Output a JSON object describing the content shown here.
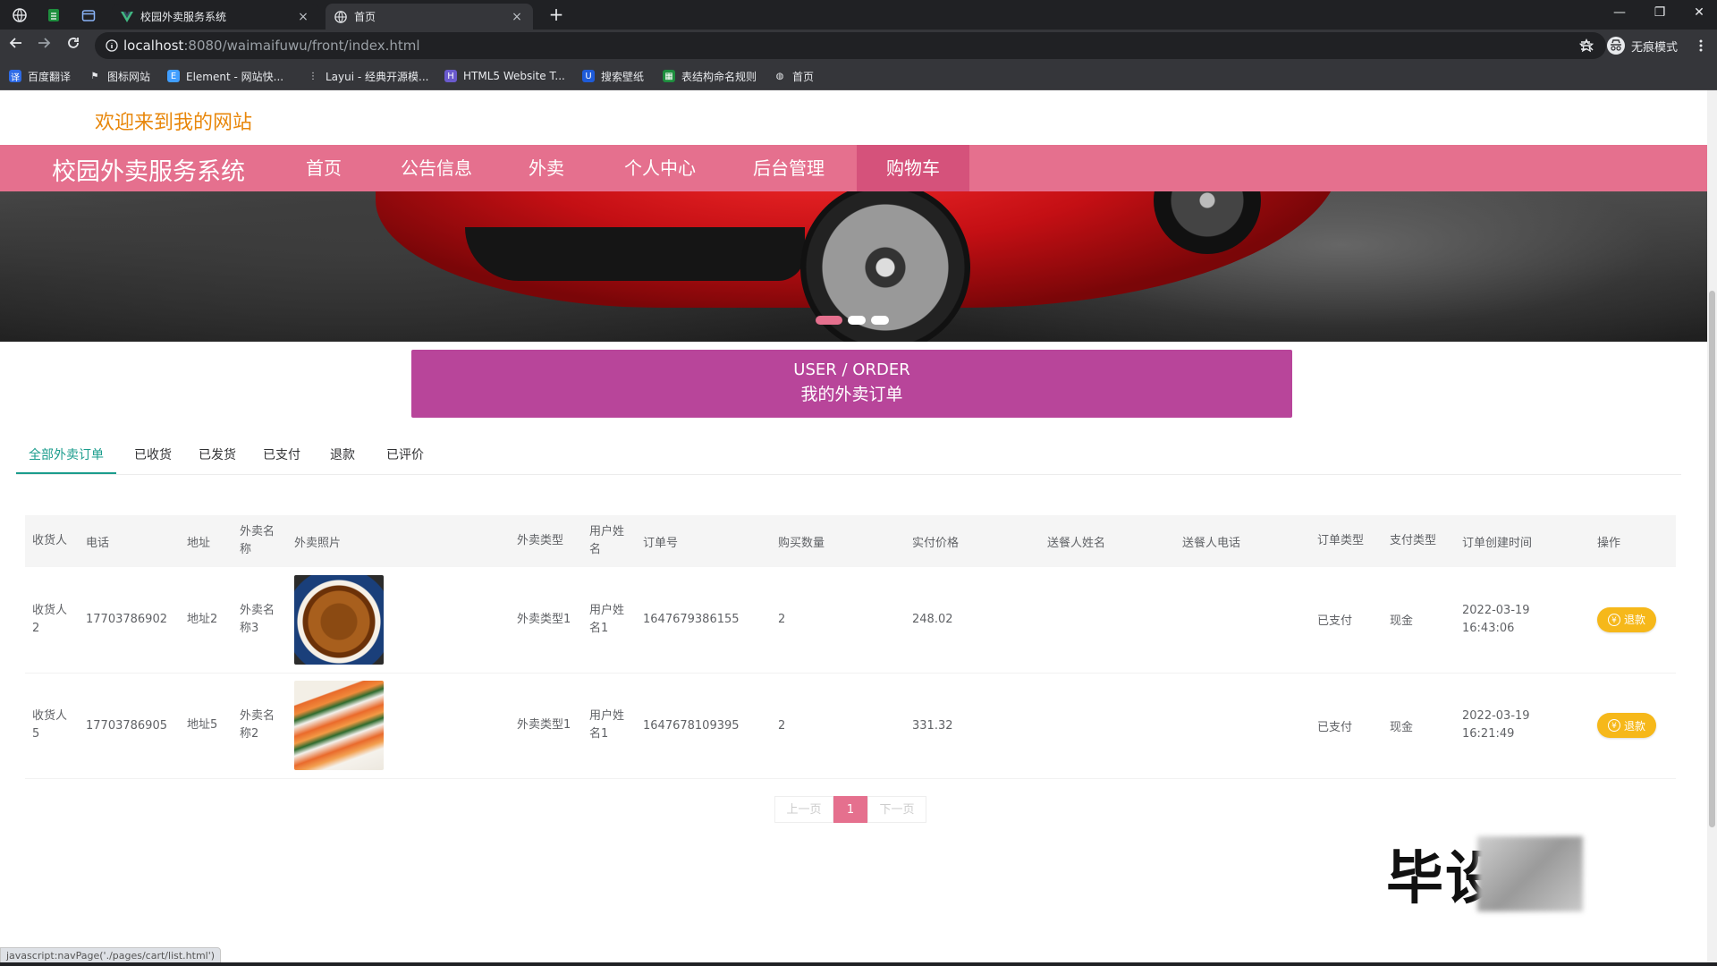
{
  "browser": {
    "tabs": [
      {
        "title": "校园外卖服务系统",
        "close": "×"
      },
      {
        "title": "首页",
        "close": "×"
      }
    ],
    "new_tab": "+",
    "window_controls": {
      "minimize": "—",
      "restore": "❐",
      "close": "✕"
    },
    "url_host": "localhost",
    "url_rest": ":8080/waimaifuwu/front/index.html",
    "profile_label": "无痕模式",
    "bookmarks": [
      "百度翻译",
      "图标网站",
      "Element - 网站快...",
      "Layui - 经典开源模...",
      "HTML5 Website T...",
      "搜索壁纸",
      "表结构命名规则",
      "首页"
    ]
  },
  "header": {
    "welcome": "欢迎来到我的网站",
    "site_title": "校园外卖服务系统",
    "nav": [
      "首页",
      "公告信息",
      "外卖",
      "个人中心",
      "后台管理",
      "购物车"
    ],
    "active_nav_index": 5
  },
  "carousel": {
    "slide_count": 3,
    "active_index": 0
  },
  "section_title": {
    "en": "USER / ORDER",
    "cn": "我的外卖订单"
  },
  "order_tabs": [
    "全部外卖订单",
    "已收货",
    "已发货",
    "已支付",
    "退款",
    "已评价"
  ],
  "active_order_tab": 0,
  "table": {
    "headers": [
      "收货人",
      "电话",
      "地址",
      "外卖名称",
      "外卖照片",
      "外卖类型",
      "用户姓名",
      "订单号",
      "购买数量",
      "实付价格",
      "送餐人姓名",
      "送餐人电话",
      "订单类型",
      "支付类型",
      "订单创建时间",
      "操作"
    ],
    "rows": [
      {
        "receiver": "收货人2",
        "phone": "17703786902",
        "address": "地址2",
        "food_name": "外卖名称3",
        "photo": "noodles",
        "food_type": "外卖类型1",
        "user_name": "用户姓名1",
        "order_no": "1647679386155",
        "quantity": "2",
        "price": "248.02",
        "courier_name": "",
        "courier_phone": "",
        "order_type": "已支付",
        "pay_type": "现金",
        "created_date": "2022-03-19",
        "created_time": "16:43:06",
        "action": "退款"
      },
      {
        "receiver": "收货人5",
        "phone": "17703786905",
        "address": "地址5",
        "food_name": "外卖名称2",
        "photo": "sushi",
        "food_type": "外卖类型1",
        "user_name": "用户姓名1",
        "order_no": "1647678109395",
        "quantity": "2",
        "price": "331.32",
        "courier_name": "",
        "courier_phone": "",
        "order_type": "已支付",
        "pay_type": "现金",
        "created_date": "2022-03-19",
        "created_time": "16:21:49",
        "action": "退款"
      }
    ]
  },
  "pagination": {
    "prev": "上一页",
    "current": "1",
    "next": "下一页"
  },
  "watermark": "毕设",
  "status_bar": "javascript:navPage('./pages/cart/list.html')",
  "colors": {
    "nav_pink": "#e5708e",
    "title_purple": "#b8459a",
    "welcome_orange": "#e8870b",
    "tab_teal": "#1a9c8c",
    "refund_yellow": "#f6b81a"
  }
}
